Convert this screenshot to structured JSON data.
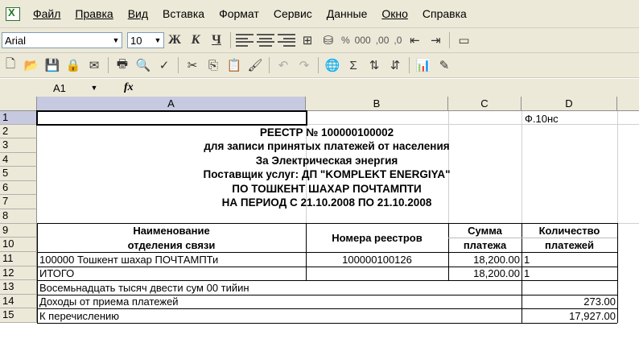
{
  "menu": {
    "items": [
      "Файл",
      "Правка",
      "Вид",
      "Вставка",
      "Формат",
      "Сервис",
      "Данные",
      "Окно",
      "Справка"
    ]
  },
  "toolbar": {
    "font_name": "Arial",
    "font_size": "10",
    "bold_label": "Ж",
    "italic_label": "К",
    "underline_label": "Ч",
    "percent_label": "%",
    "thousands_label": "000",
    "increase_decimal_label": ",00",
    "decrease_decimal_label": ",0",
    "sum_label": "Σ"
  },
  "formula_bar": {
    "cell_ref": "A1",
    "fx_label": "fx",
    "value": ""
  },
  "columns": [
    "A",
    "B",
    "C",
    "D"
  ],
  "rows": [
    "1",
    "2",
    "3",
    "4",
    "5",
    "6",
    "7",
    "8",
    "9",
    "10",
    "11",
    "12",
    "13",
    "14",
    "15"
  ],
  "sheet": {
    "form_code": "Ф.10нс",
    "title_lines": [
      "РЕЕСТР № 100000100002",
      "для записи принятых платежей от населения",
      "За Электрическая энергия",
      "Поставщик услуг: ДП \"KOMPLEKT ENERGIYA\"",
      "ПО ТОШКЕНТ ШАХАР ПОЧТАМПТИ",
      "НА ПЕРИОД С 21.10.2008 ПО 21.10.2008"
    ],
    "table_headers": {
      "col_a_line1": "Наименование",
      "col_a_line2": "отделения связи",
      "col_b": "Номера реестров",
      "col_c_line1": "Сумма",
      "col_c_line2": "платежа",
      "col_d_line1": "Количество",
      "col_d_line2": "платежей"
    },
    "data_row": {
      "name": "100000 Тошкент шахар ПОЧТАМПТи",
      "registry": "100000100126",
      "amount": "18,200.00",
      "count": "1"
    },
    "total_row": {
      "label": "ИТОГО",
      "amount": "18,200.00",
      "count": "1"
    },
    "amount_words": "Восемьнадцать тысяч двести сум 00 тийин",
    "income_label": "Доходы от приема платежей",
    "income_value": "273.00",
    "transfer_label": "К перечислению",
    "transfer_value": "17,927.00"
  }
}
